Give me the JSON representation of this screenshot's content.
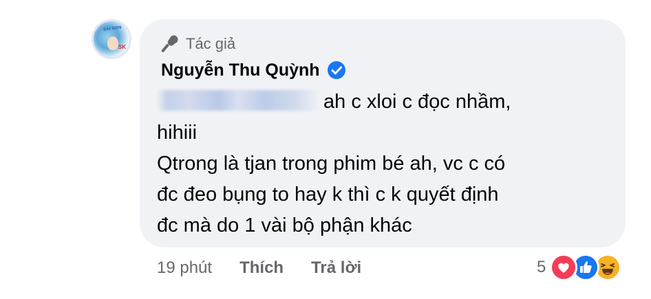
{
  "comment": {
    "badge_label": "Tác giả",
    "author": "Nguyễn Thu Quỳnh",
    "mention_blurred": true,
    "lines": [
      "ah c xloi c đọc nhầm,",
      "hihiii",
      "Qtrong là tjan trong phim bé ah, vc c có",
      "đc đeo bụng to hay k thì c k quyết định",
      "đc mà do 1 vài bộ phận khác"
    ]
  },
  "actions": {
    "time": "19 phút",
    "like_label": "Thích",
    "reply_label": "Trả lời"
  },
  "reactions": {
    "count": "5",
    "types": [
      "love-icon",
      "like-icon",
      "haha-icon"
    ]
  },
  "colors": {
    "bubble": "#f0f2f5",
    "secondary_text": "#65676b",
    "verified": "#1877f2",
    "love": "#f33e58",
    "like": "#1877f2",
    "haha": "#f7b125"
  }
}
